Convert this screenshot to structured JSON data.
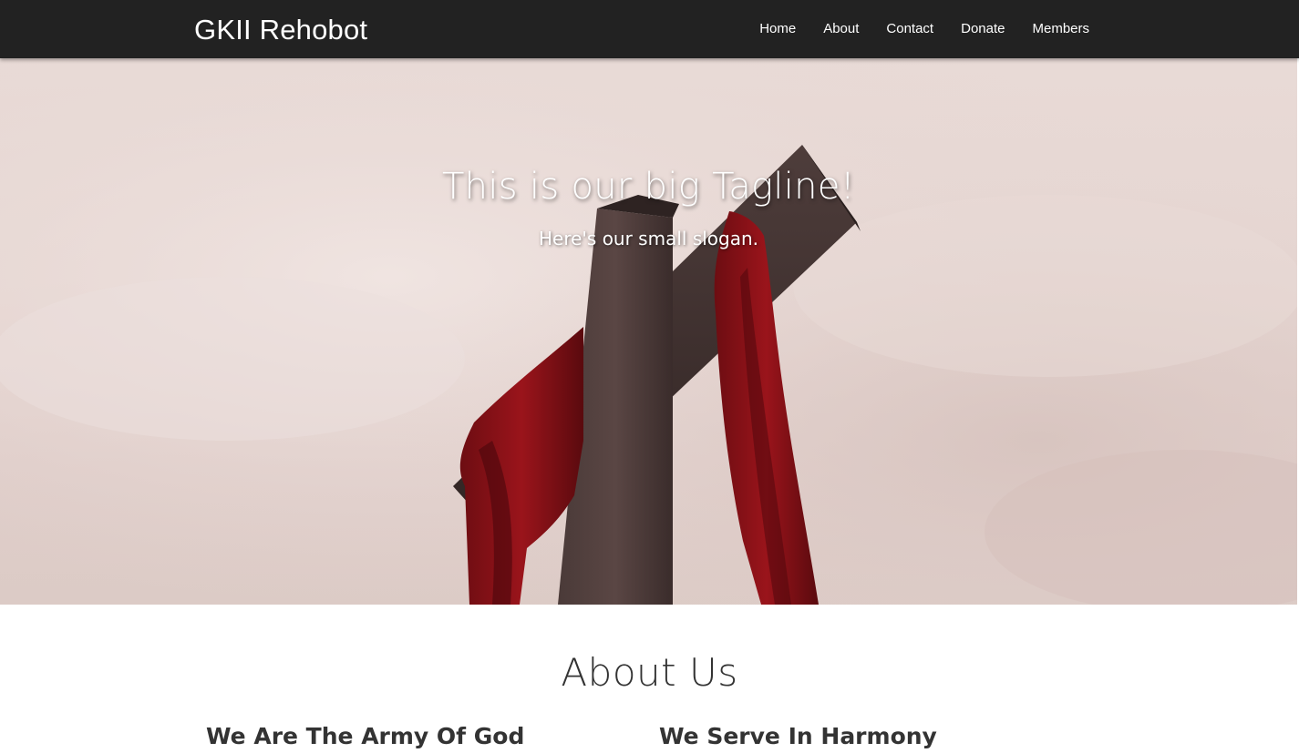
{
  "navbar": {
    "brand": "GKII Rehobot",
    "links": [
      "Home",
      "About",
      "Contact",
      "Donate",
      "Members"
    ],
    "background": "#222222"
  },
  "hero": {
    "tagline": "This is our big Tagline!",
    "slogan": "Here's our small slogan.",
    "image": "cross-with-red-cloth-image"
  },
  "about": {
    "title": "About Us",
    "columns": [
      {
        "title": "We Are The Army Of God"
      },
      {
        "title": "We Serve In Harmony"
      }
    ]
  }
}
